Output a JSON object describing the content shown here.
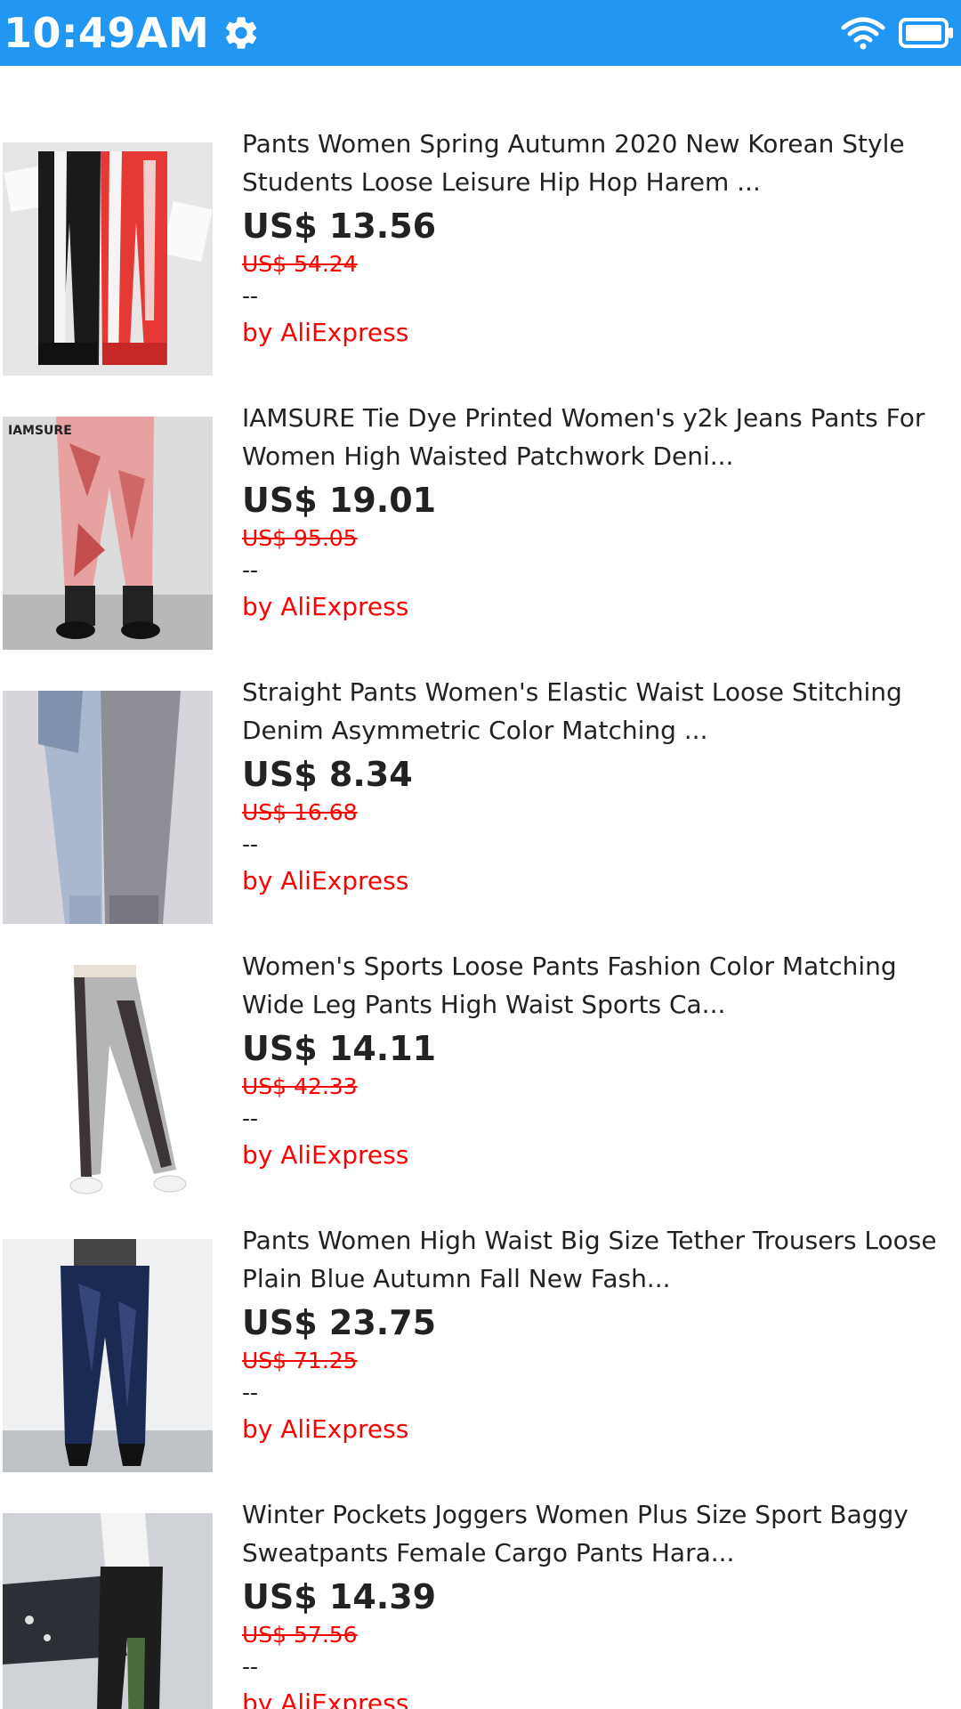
{
  "status_bar": {
    "time": "10:49AM",
    "icons": [
      "gear-icon",
      "wifi-icon",
      "battery-icon"
    ],
    "background": "#2196F3"
  },
  "colors": {
    "accent": "#2196F3",
    "price_text": "#222222",
    "sale_red": "#ff0000"
  },
  "products": [
    {
      "title": "Pants Women Spring Autumn 2020 New Korean Style Students Loose Leisure Hip Hop Harem ...",
      "price": "US$ 13.56",
      "original_price": "US$ 54.24",
      "rating": "--",
      "seller": "by AliExpress"
    },
    {
      "title": "IAMSURE Tie Dye Printed Women's y2k Jeans Pants For Women High Waisted Patchwork Deni...",
      "price": "US$ 19.01",
      "original_price": "US$ 95.05",
      "rating": "--",
      "seller": "by AliExpress",
      "image_text": "IAMSURE"
    },
    {
      "title": "Straight Pants Women's Elastic Waist Loose Stitching Denim Asymmetric Color Matching ...",
      "price": "US$ 8.34",
      "original_price": "US$ 16.68",
      "rating": "--",
      "seller": "by AliExpress"
    },
    {
      "title": "Women's Sports Loose Pants Fashion Color Matching Wide Leg Pants High Waist Sports Ca...",
      "price": "US$ 14.11",
      "original_price": "US$ 42.33",
      "rating": "--",
      "seller": "by AliExpress"
    },
    {
      "title": "Pants Women High Waist Big Size Tether Trousers Loose Plain Blue Autumn Fall New Fash...",
      "price": "US$ 23.75",
      "original_price": "US$ 71.25",
      "rating": "--",
      "seller": "by AliExpress"
    },
    {
      "title": "Winter Pockets Joggers Women Plus Size Sport Baggy Sweatpants Female Cargo Pants Hara...",
      "price": "US$ 14.39",
      "original_price": "US$ 57.56",
      "rating": "--",
      "seller": "by AliExpress"
    }
  ]
}
